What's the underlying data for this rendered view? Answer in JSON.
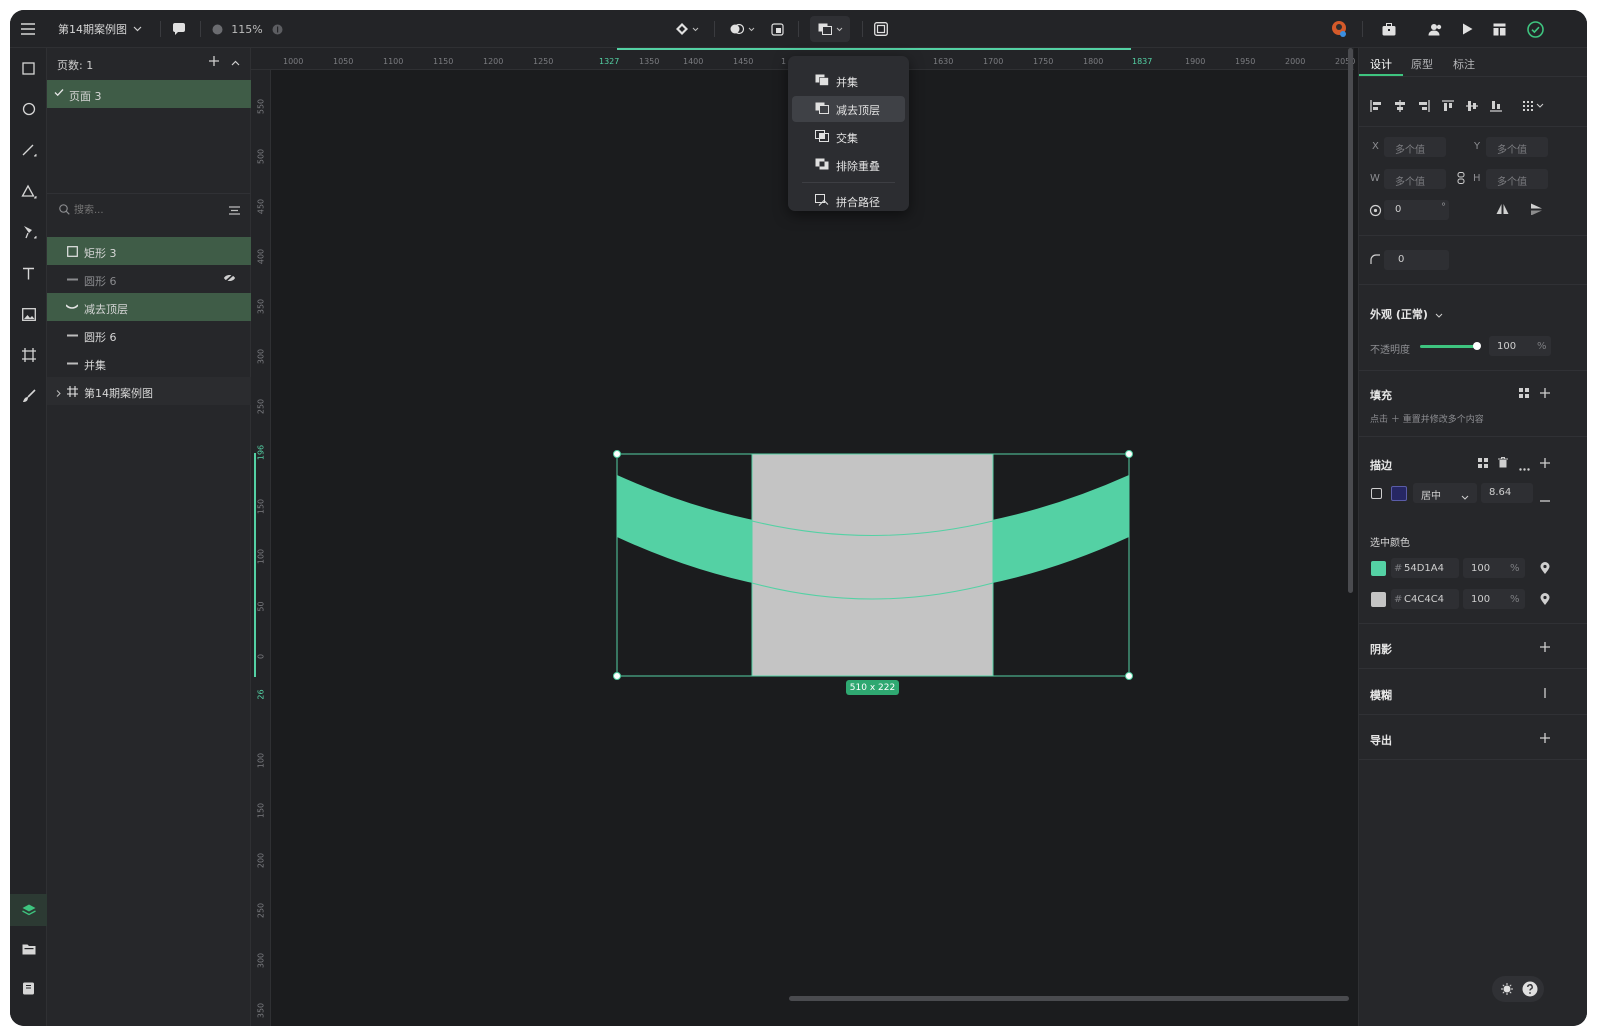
{
  "topbar": {
    "file_name": "第14期案例图",
    "zoom": "115%"
  },
  "pages": {
    "count_label": "页数: 1",
    "items": [
      {
        "label": "页面 3"
      }
    ]
  },
  "layers": {
    "search_placeholder": "搜索...",
    "items": [
      {
        "label": "矩形 3",
        "selected": true
      },
      {
        "label": "圆形 6",
        "hidden": true
      },
      {
        "label": "减去顶层",
        "selected": true
      },
      {
        "label": "圆形 6"
      },
      {
        "label": "并集"
      },
      {
        "label": "第14期案例图"
      }
    ]
  },
  "ruler": {
    "x_ticks": [
      "1000",
      "1050",
      "1100",
      "1150",
      "1200",
      "1250",
      "1327",
      "1350",
      "1400",
      "1450",
      "1",
      "1630",
      "1700",
      "1750",
      "1800",
      "1837",
      "1900",
      "1950",
      "2000",
      "2050"
    ],
    "y_ticks": [
      "550",
      "500",
      "450",
      "400",
      "350",
      "300",
      "250",
      "196",
      "150",
      "100",
      "50",
      "0",
      "26",
      "100",
      "150",
      "200",
      "250",
      "300",
      "350"
    ]
  },
  "boolean_menu": {
    "items": [
      {
        "label": "并集",
        "icon": "union-icon"
      },
      {
        "label": "减去顶层",
        "icon": "subtract-icon",
        "highlighted": true
      },
      {
        "label": "交集",
        "icon": "intersect-icon"
      },
      {
        "label": "排除重叠",
        "icon": "exclude-icon"
      },
      {
        "label": "拼合路径",
        "icon": "flatten-icon"
      }
    ]
  },
  "selection": {
    "size_label": "510 x 222",
    "fill_colors": {
      "green": "#54D1A4",
      "gray": "#C4C4C4"
    }
  },
  "props": {
    "tabs": [
      "设计",
      "原型",
      "标注"
    ],
    "x_label": "X",
    "y_label": "Y",
    "w_label": "W",
    "h_label": "H",
    "x_value": "多个值",
    "y_value": "多个值",
    "w_value": "多个值",
    "h_value": "多个值",
    "rotation": "0",
    "degree": "°",
    "radius": "0",
    "appearance_title": "外观 (正常)",
    "opacity_label": "不透明度",
    "opacity_value": "100",
    "percent": "%",
    "fill_title": "填充",
    "fill_hint": "点击 ＋ 重置并修改多个内容",
    "stroke_title": "描边",
    "stroke_align": "居中",
    "stroke_width": "8.64",
    "selected_colors_title": "选中颜色",
    "colors": [
      {
        "hex": "54D1A4",
        "opacity": "100",
        "swatch": "#54D1A4"
      },
      {
        "hex": "C4C4C4",
        "opacity": "100",
        "swatch": "#C4C4C4"
      }
    ],
    "hash": "#",
    "shadow_title": "阴影",
    "blur_title": "模糊",
    "export_title": "导出"
  }
}
